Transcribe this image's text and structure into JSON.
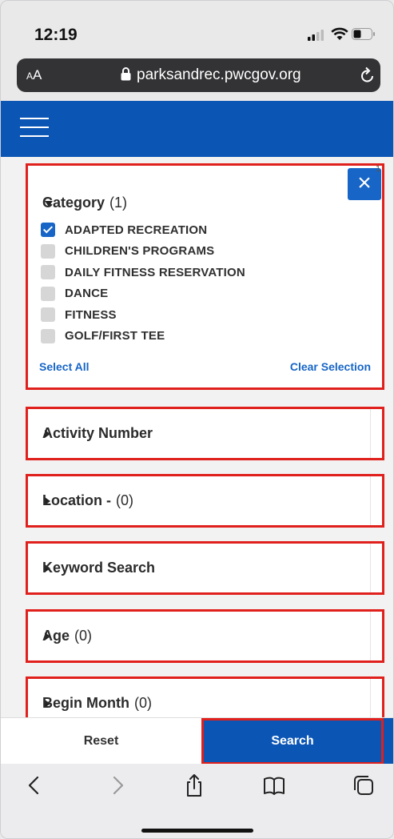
{
  "status_bar": {
    "time": "12:19"
  },
  "url_bar": {
    "text_size_label": "AA",
    "domain": "parksandrec.pwcgov.org"
  },
  "header": {
    "menu_icon": "hamburger-icon"
  },
  "filters": {
    "category": {
      "title": "Category",
      "count": "(1)",
      "badge": "1",
      "options": [
        {
          "label": "ADAPTED RECREATION",
          "checked": true
        },
        {
          "label": "CHILDREN'S PROGRAMS",
          "checked": false
        },
        {
          "label": "DAILY FITNESS RESERVATION",
          "checked": false
        },
        {
          "label": "DANCE",
          "checked": false
        },
        {
          "label": "FITNESS",
          "checked": false
        },
        {
          "label": "GOLF/FIRST TEE",
          "checked": false
        }
      ],
      "select_all": "Select All",
      "clear_selection": "Clear Selection"
    },
    "activity_number": {
      "title": "Activity Number"
    },
    "location": {
      "title": "Location -",
      "count": "(0)"
    },
    "keyword": {
      "title": "Keyword Search"
    },
    "age": {
      "title": "Age",
      "count": "(0)"
    },
    "begin_month": {
      "title": "Begin Month",
      "count": "(0)"
    }
  },
  "actions": {
    "reset": "Reset",
    "search": "Search"
  },
  "colors": {
    "brand_blue": "#0b55b5",
    "highlight_red": "#e0201c",
    "link_blue": "#1665c7"
  }
}
